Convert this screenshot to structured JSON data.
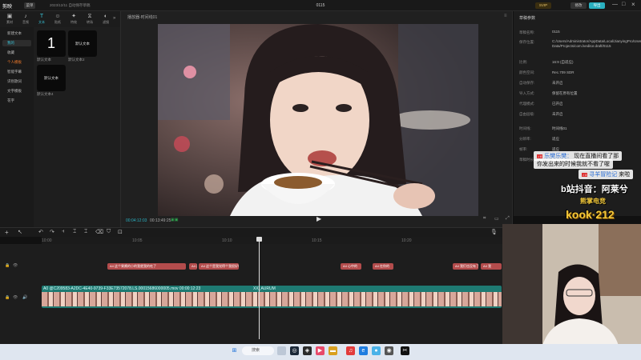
{
  "app": {
    "name": "剪映",
    "menu": "菜单",
    "notice": "2023/12/11 自动保存草稿",
    "project_title": "0115",
    "svip": "SVIP",
    "modify": "修改",
    "export": "导出"
  },
  "tools": [
    {
      "icon": "media",
      "label": "素材"
    },
    {
      "icon": "audio",
      "label": "音频"
    },
    {
      "icon": "text",
      "label": "文本"
    },
    {
      "icon": "sticker",
      "label": "贴纸"
    },
    {
      "icon": "effects",
      "label": "特效"
    },
    {
      "icon": "transition",
      "label": "转场"
    },
    {
      "icon": "filter",
      "label": "滤镜"
    },
    {
      "icon": "adjust",
      "label": "调节"
    },
    {
      "icon": "template",
      "label": "模板"
    }
  ],
  "sidebar": [
    {
      "label": "新建文本"
    },
    {
      "label": "我的"
    },
    {
      "label": "收藏"
    },
    {
      "label": "个人模板"
    },
    {
      "label": "智能字幕"
    },
    {
      "label": "识别歌词"
    },
    {
      "label": "文字模板"
    },
    {
      "label": "花字"
    }
  ],
  "assets": [
    {
      "label": "默认文本",
      "glyph": "1"
    },
    {
      "label": "默认文本2",
      "glyph": "默认文本"
    },
    {
      "label": "默认文本4",
      "glyph": "默认文本"
    }
  ],
  "player": {
    "title": "播放器-时间线01",
    "current": "00:04:12:03",
    "total": "00:13:49:25"
  },
  "details": {
    "title": "草稿参数",
    "rows": [
      {
        "k": "草稿名称:",
        "v": "0115"
      },
      {
        "k": "保存位置:",
        "v": "C:/Users/Administrator/AppData/Local/JianyingPro/User Data/Projects/com.lveditor.draft/0115"
      },
      {
        "k": "比例:",
        "v": "16:9 (自适应)"
      },
      {
        "k": "颜色空间:",
        "v": "Rec.709 SDR"
      },
      {
        "k": "自动保存:",
        "v": "未开启"
      },
      {
        "k": "导入方式:",
        "v": "保留在原有位置"
      },
      {
        "k": "代理模式:",
        "v": "已开启"
      },
      {
        "k": "自由层级:",
        "v": "未开启"
      },
      {
        "k": "时间线:",
        "v": "时间线01"
      },
      {
        "k": "分辨率:",
        "v": "适应"
      },
      {
        "k": "帧率:",
        "v": "适应"
      },
      {
        "k": "草稿时长:",
        "v": "00:14:00"
      }
    ]
  },
  "timeline": {
    "ruler": [
      "10:00",
      "10:05",
      "10:10",
      "10:15",
      "10:20"
    ],
    "text_clips": [
      "A4 这个果酱的小的我就我的吃了",
      "A4 这",
      "A4 这个是我觉得个我很好吃",
      "A4 心中的",
      "A4 在你的",
      "A4 我们也没有了",
      "A4 我"
    ],
    "video_label": "A0 @C209583-A2DC-4E40-9739-F33E73572078.LS.00015686000005.mov  00:00:12:23",
    "video_label2": "XX_AURUM"
  },
  "chat": [
    {
      "badge": "♪ 6",
      "user": "乐樊乐樊：",
      "text": "现在直播间看了那",
      "text2": "你发出来的时候我就不看了喔"
    },
    {
      "badge": "♪ 4",
      "user": "寻羊冒险记",
      "text": "来啦"
    }
  ],
  "overlay": {
    "promo": "b站抖音：阿莱兮",
    "brand1": "熊掌电竞",
    "brand2": "kook·212"
  },
  "taskbar": {
    "search": "搜索"
  }
}
